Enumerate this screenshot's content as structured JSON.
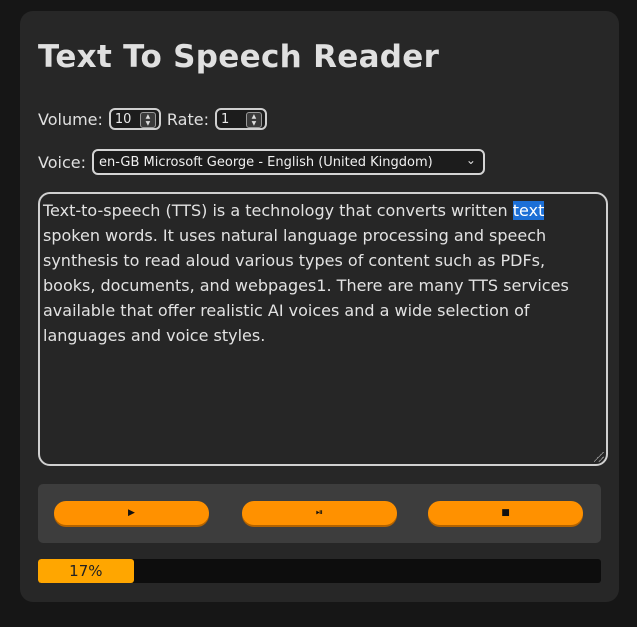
{
  "app": {
    "title": "Text To Speech Reader"
  },
  "controls_row": {
    "volume_label": "Volume:",
    "volume_value": "10",
    "rate_label": "Rate:",
    "rate_value": "1"
  },
  "voice": {
    "label": "Voice:",
    "selected": "en-GB Microsoft George - English (United Kingdom)"
  },
  "text": {
    "before_highlight": "Text-to-speech (TTS) is a technology that converts written ",
    "highlighted_word": "text",
    "after_highlight": " spoken words. It uses natural language processing and speech synthesis to read aloud various types of content such as PDFs, books, documents, and webpages1. There are many TTS services available that offer realistic AI voices and a wide selection of languages and voice styles."
  },
  "buttons": {
    "play_icon": "▶",
    "pause_icon": "⏯",
    "stop_icon": "■"
  },
  "progress": {
    "label": "17%",
    "fraction": 0.17
  },
  "colors": {
    "accent": "#ff9100",
    "progress_fill": "#ffa600",
    "highlight": "#1c6fd6",
    "card": "#272727",
    "background": "#161616"
  }
}
